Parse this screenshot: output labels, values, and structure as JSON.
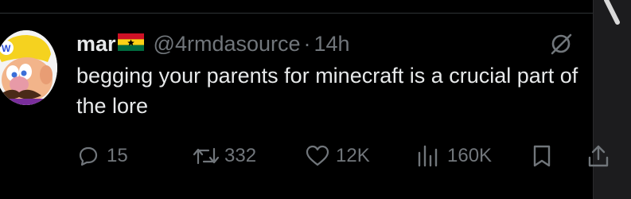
{
  "tweet": {
    "display_name": "mar",
    "handle": "@4rmdasource",
    "separator": "·",
    "time": "14h",
    "text": "begging your parents for minecraft is a crucial part of the lore"
  },
  "actions": {
    "replies": "15",
    "reposts": "332",
    "likes": "12K",
    "views": "160K"
  },
  "icons": {
    "reply": "reply-icon",
    "repost": "repost-icon",
    "like": "like-icon",
    "views": "views-icon",
    "bookmark": "bookmark-icon",
    "share": "share-icon",
    "grok": "grok-icon",
    "flag": "ghana-flag-icon"
  },
  "colors": {
    "background": "#000000",
    "text_primary": "#e7e9ea",
    "text_secondary": "#71767b",
    "divider": "#2f3336"
  }
}
